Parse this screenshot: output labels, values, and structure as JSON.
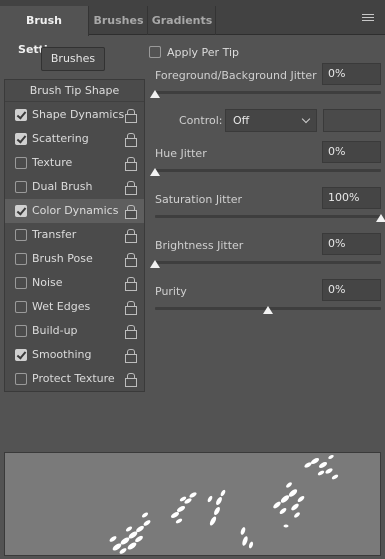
{
  "tabs": [
    "Brush Settings",
    "Brushes",
    "Gradients"
  ],
  "brushes_button": "Brushes",
  "brush_tip_shape": "Brush Tip Shape",
  "options": [
    {
      "label": "Shape Dynamics",
      "checked": true
    },
    {
      "label": "Scattering",
      "checked": true
    },
    {
      "label": "Texture",
      "checked": false
    },
    {
      "label": "Dual Brush",
      "checked": false
    },
    {
      "label": "Color Dynamics",
      "checked": true,
      "selected": true
    },
    {
      "label": "Transfer",
      "checked": false
    },
    {
      "label": "Brush Pose",
      "checked": false
    },
    {
      "label": "Noise",
      "checked": false
    },
    {
      "label": "Wet Edges",
      "checked": false
    },
    {
      "label": "Build-up",
      "checked": false
    },
    {
      "label": "Smoothing",
      "checked": true
    },
    {
      "label": "Protect Texture",
      "checked": false
    }
  ],
  "apply_per_tip": {
    "label": "Apply Per Tip",
    "checked": false
  },
  "fg_bg_jitter": {
    "label": "Foreground/Background Jitter",
    "value": "0%",
    "level": 0
  },
  "control": {
    "label": "Control:",
    "value": "Off"
  },
  "hue_jitter": {
    "label": "Hue Jitter",
    "value": "0%",
    "level": 0
  },
  "saturation_jitter": {
    "label": "Saturation Jitter",
    "value": "100%",
    "level": 1
  },
  "brightness_jitter": {
    "label": "Brightness Jitter",
    "value": "0%",
    "level": 0
  },
  "purity": {
    "label": "Purity",
    "value": "0%",
    "level": 0.5
  },
  "colors": {
    "panel": "#535353",
    "tab_bar": "#424242",
    "preview": "#7a7a7a",
    "selected_row": "#5e5e5e"
  }
}
